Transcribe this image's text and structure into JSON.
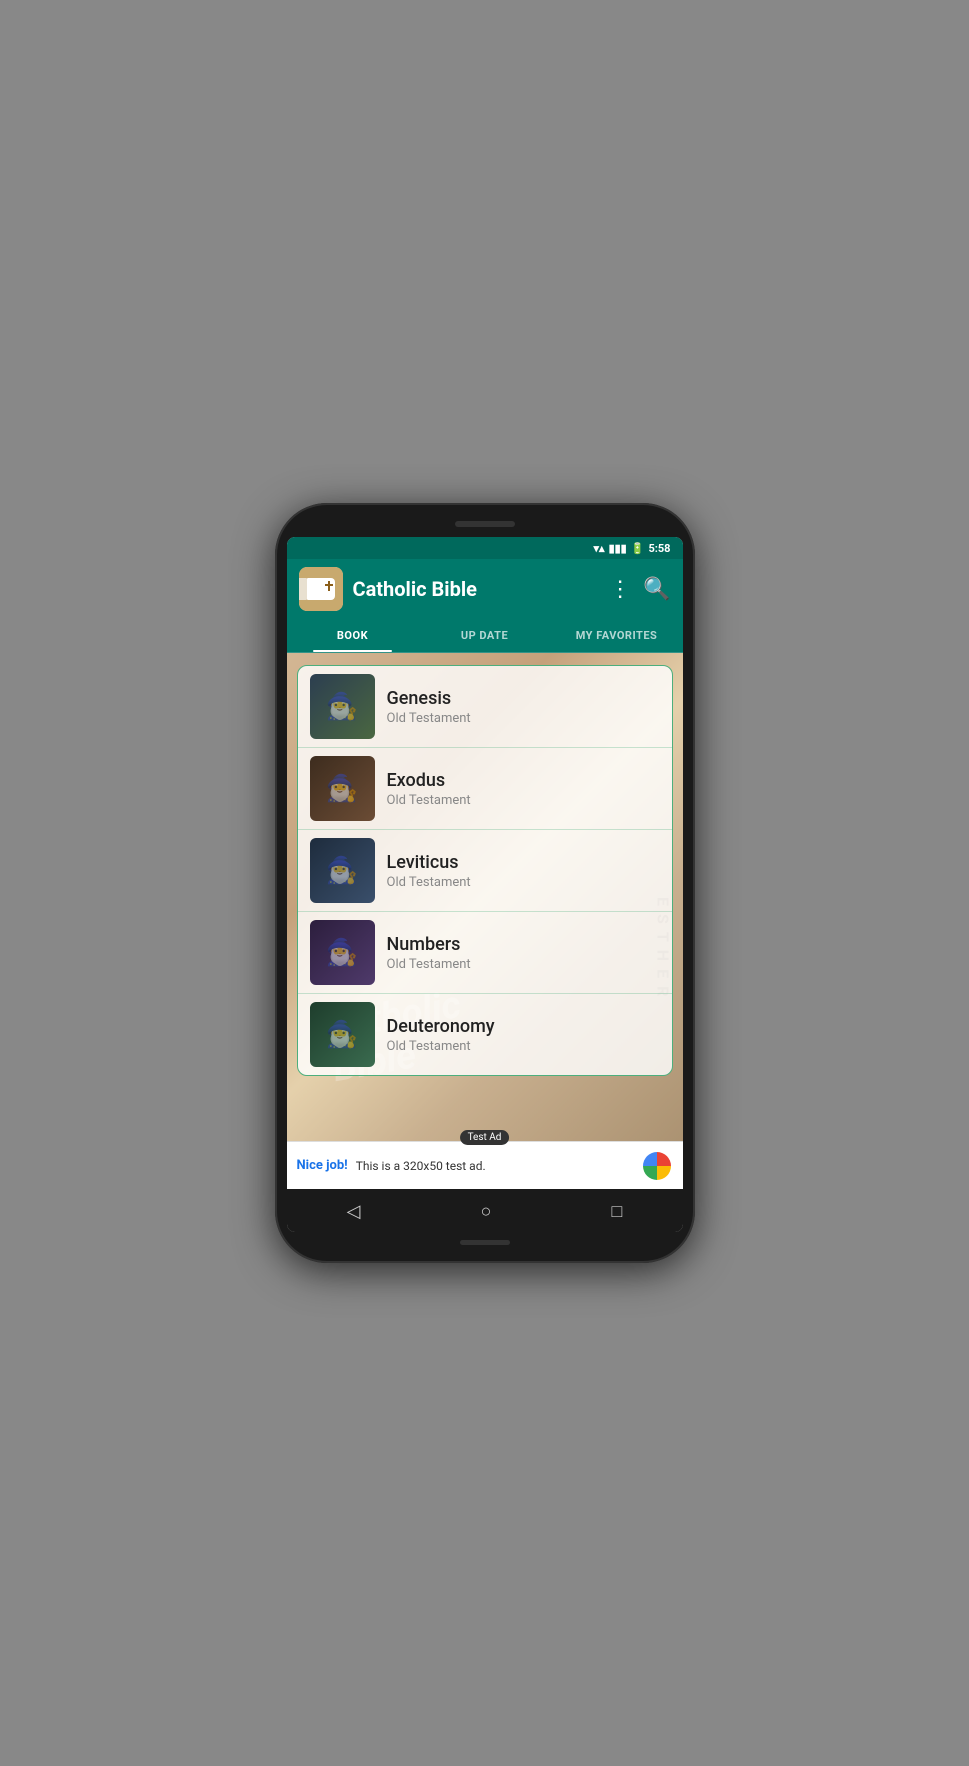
{
  "statusBar": {
    "time": "5:58",
    "icons": [
      "wifi",
      "signal",
      "battery"
    ]
  },
  "header": {
    "title": "Catholic Bible",
    "logoAlt": "Catholic Bible logo"
  },
  "tabs": [
    {
      "id": "book",
      "label": "BOOK",
      "active": true
    },
    {
      "id": "update",
      "label": "UP DATE",
      "active": false
    },
    {
      "id": "favorites",
      "label": "MY FAVORITES",
      "active": false
    }
  ],
  "books": [
    {
      "id": 1,
      "name": "Genesis",
      "testament": "Old Testament",
      "emoji": "🧙"
    },
    {
      "id": 2,
      "name": "Exodus",
      "testament": "Old Testament",
      "emoji": "🧙"
    },
    {
      "id": 3,
      "name": "Leviticus",
      "testament": "Old Testament",
      "emoji": "🧙"
    },
    {
      "id": 4,
      "name": "Numbers",
      "testament": "Old Testament",
      "emoji": "🧙"
    },
    {
      "id": 5,
      "name": "Deuteronomy",
      "testament": "Old Testament",
      "emoji": "🧙"
    }
  ],
  "ad": {
    "label": "Test Ad",
    "niceJob": "Nice job!",
    "text": "This is a 320x50 test ad."
  },
  "navigation": {
    "back": "◁",
    "home": "○",
    "recents": "□"
  }
}
